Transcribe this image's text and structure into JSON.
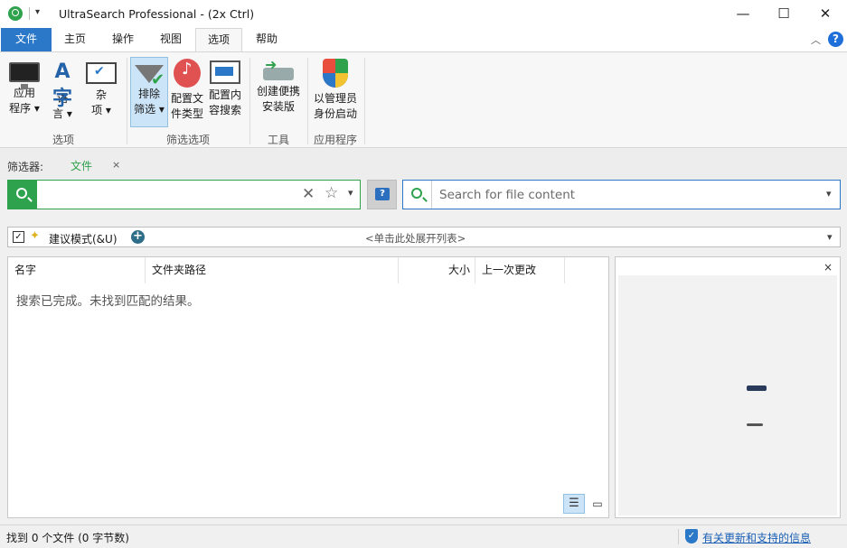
{
  "window": {
    "title": "UltraSearch Professional  -  (2x Ctrl)",
    "min_glyph": "—",
    "max_glyph": "☐",
    "close_glyph": "✕"
  },
  "tabs": [
    "文件",
    "主页",
    "操作",
    "视图",
    "选项",
    "帮助"
  ],
  "ribbon": {
    "groups": {
      "options": "选项",
      "filter_options": "筛选选项",
      "tools": "工具",
      "application": "应用程序"
    },
    "buttons": {
      "app_line1": "应用",
      "app_line2": "程序 ▾",
      "lang_line1": "语",
      "lang_line2": "言 ▾",
      "misc_line1": "杂",
      "misc_line2": "项 ▾",
      "exclude_line1": "排除",
      "exclude_line2": "筛选 ▾",
      "filetype_line1": "配置文",
      "filetype_line2": "件类型",
      "content_line1": "配置内",
      "content_line2": "容搜索",
      "portable_line1": "创建便携",
      "portable_line2": "安装版",
      "admin_line1": "以管理员",
      "admin_line2": "身份启动"
    },
    "icons": [
      "monitor-icon",
      "language-icon",
      "checkbox-icon",
      "funnel-icon",
      "music-file-icon",
      "content-search-icon",
      "usb-drive-icon",
      "shield-icon"
    ]
  },
  "filter": {
    "label": "筛选器:",
    "chip": "文件",
    "close": "×"
  },
  "search": {
    "value": "",
    "content_placeholder": "Search for file content"
  },
  "suggest": {
    "checked": "✓",
    "label": "建议模式(&U)",
    "hint": "<单击此处展开列表>"
  },
  "results": {
    "columns": [
      "名字",
      "文件夹路径",
      "大小",
      "上一次更改"
    ],
    "empty_message": "搜索已完成。未找到匹配的结果。"
  },
  "preview": {
    "close": "×"
  },
  "status": {
    "left": "找到 0 个文件 (0 字节数)",
    "link": "有关更新和支持的信息"
  },
  "colors": {
    "accent_green": "#2fa24d",
    "accent_blue": "#2b78c9",
    "selected_bg": "#cce4f7"
  }
}
